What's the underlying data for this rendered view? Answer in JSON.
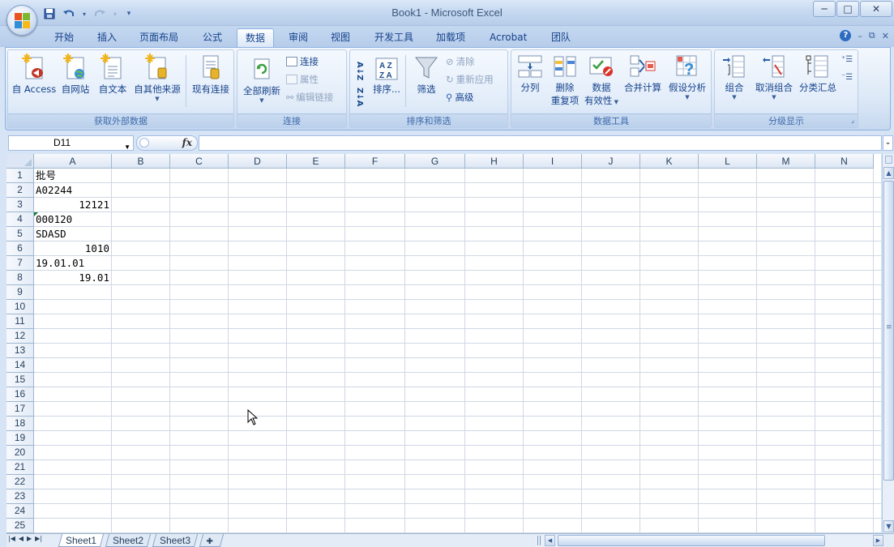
{
  "window": {
    "title": "Book1 - Microsoft Excel"
  },
  "window_controls": {
    "minimize": "─",
    "maximize": "□",
    "close": "✕"
  },
  "quick_access": {
    "customize": "▾"
  },
  "tabs": [
    {
      "label": "开始"
    },
    {
      "label": "插入"
    },
    {
      "label": "页面布局"
    },
    {
      "label": "公式"
    },
    {
      "label": "数据"
    },
    {
      "label": "审阅"
    },
    {
      "label": "视图"
    },
    {
      "label": "开发工具"
    },
    {
      "label": "加载项"
    },
    {
      "label": "Acrobat"
    },
    {
      "label": "团队"
    }
  ],
  "ribbon": {
    "external": {
      "label": "获取外部数据",
      "access": "自 Access",
      "web": "自网站",
      "text": "自文本",
      "other": "自其他来源",
      "existing": "现有连接"
    },
    "connections": {
      "label": "连接",
      "refresh_all": "全部刷新",
      "connections": "连接",
      "properties": "属性",
      "edit_links": "编辑链接"
    },
    "sort_filter": {
      "label": "排序和筛选",
      "az": "A↓Z",
      "za": "Z↓A",
      "sort": "排序...",
      "filter": "筛选",
      "clear": "清除",
      "reapply": "重新应用",
      "advanced": "高级"
    },
    "data_tools": {
      "label": "数据工具",
      "text_to_columns": "分列",
      "remove_dup_1": "删除",
      "remove_dup_2": "重复项",
      "validation_1": "数据",
      "validation_2": "有效性",
      "consolidate": "合并计算",
      "what_if": "假设分析"
    },
    "outline": {
      "label": "分级显示",
      "group": "组合",
      "ungroup": "取消组合",
      "subtotal": "分类汇总"
    }
  },
  "formula_bar": {
    "name_box": "D11",
    "fx": "fx",
    "formula": "",
    "expand": "⌄"
  },
  "grid": {
    "columns": [
      "A",
      "B",
      "C",
      "D",
      "E",
      "F",
      "G",
      "H",
      "I",
      "J",
      "K",
      "L",
      "M",
      "N"
    ],
    "rows": [
      "1",
      "2",
      "3",
      "4",
      "5",
      "6",
      "7",
      "8",
      "9",
      "10",
      "11",
      "12",
      "13",
      "14",
      "15",
      "16",
      "17",
      "18",
      "19",
      "20",
      "21",
      "22",
      "23",
      "24",
      "25"
    ],
    "cells": [
      {
        "ref": "A1",
        "value": "批号",
        "align": "left"
      },
      {
        "ref": "A2",
        "value": "A02244",
        "align": "left"
      },
      {
        "ref": "A3",
        "value": "12121",
        "align": "right"
      },
      {
        "ref": "A4",
        "value": "000120",
        "align": "left",
        "error_indicator": true
      },
      {
        "ref": "A5",
        "value": "SDASD",
        "align": "left"
      },
      {
        "ref": "A6",
        "value": "1010",
        "align": "right"
      },
      {
        "ref": "A7",
        "value": "19.01.01",
        "align": "left"
      },
      {
        "ref": "A8",
        "value": "19.01",
        "align": "right"
      }
    ]
  },
  "sheets": [
    {
      "label": "Sheet1",
      "active": true
    },
    {
      "label": "Sheet2",
      "active": false
    },
    {
      "label": "Sheet3",
      "active": false
    }
  ],
  "help_icon": "?",
  "mdi_controls": {
    "minimize": "–",
    "restore": "⧉",
    "close": "✕"
  }
}
